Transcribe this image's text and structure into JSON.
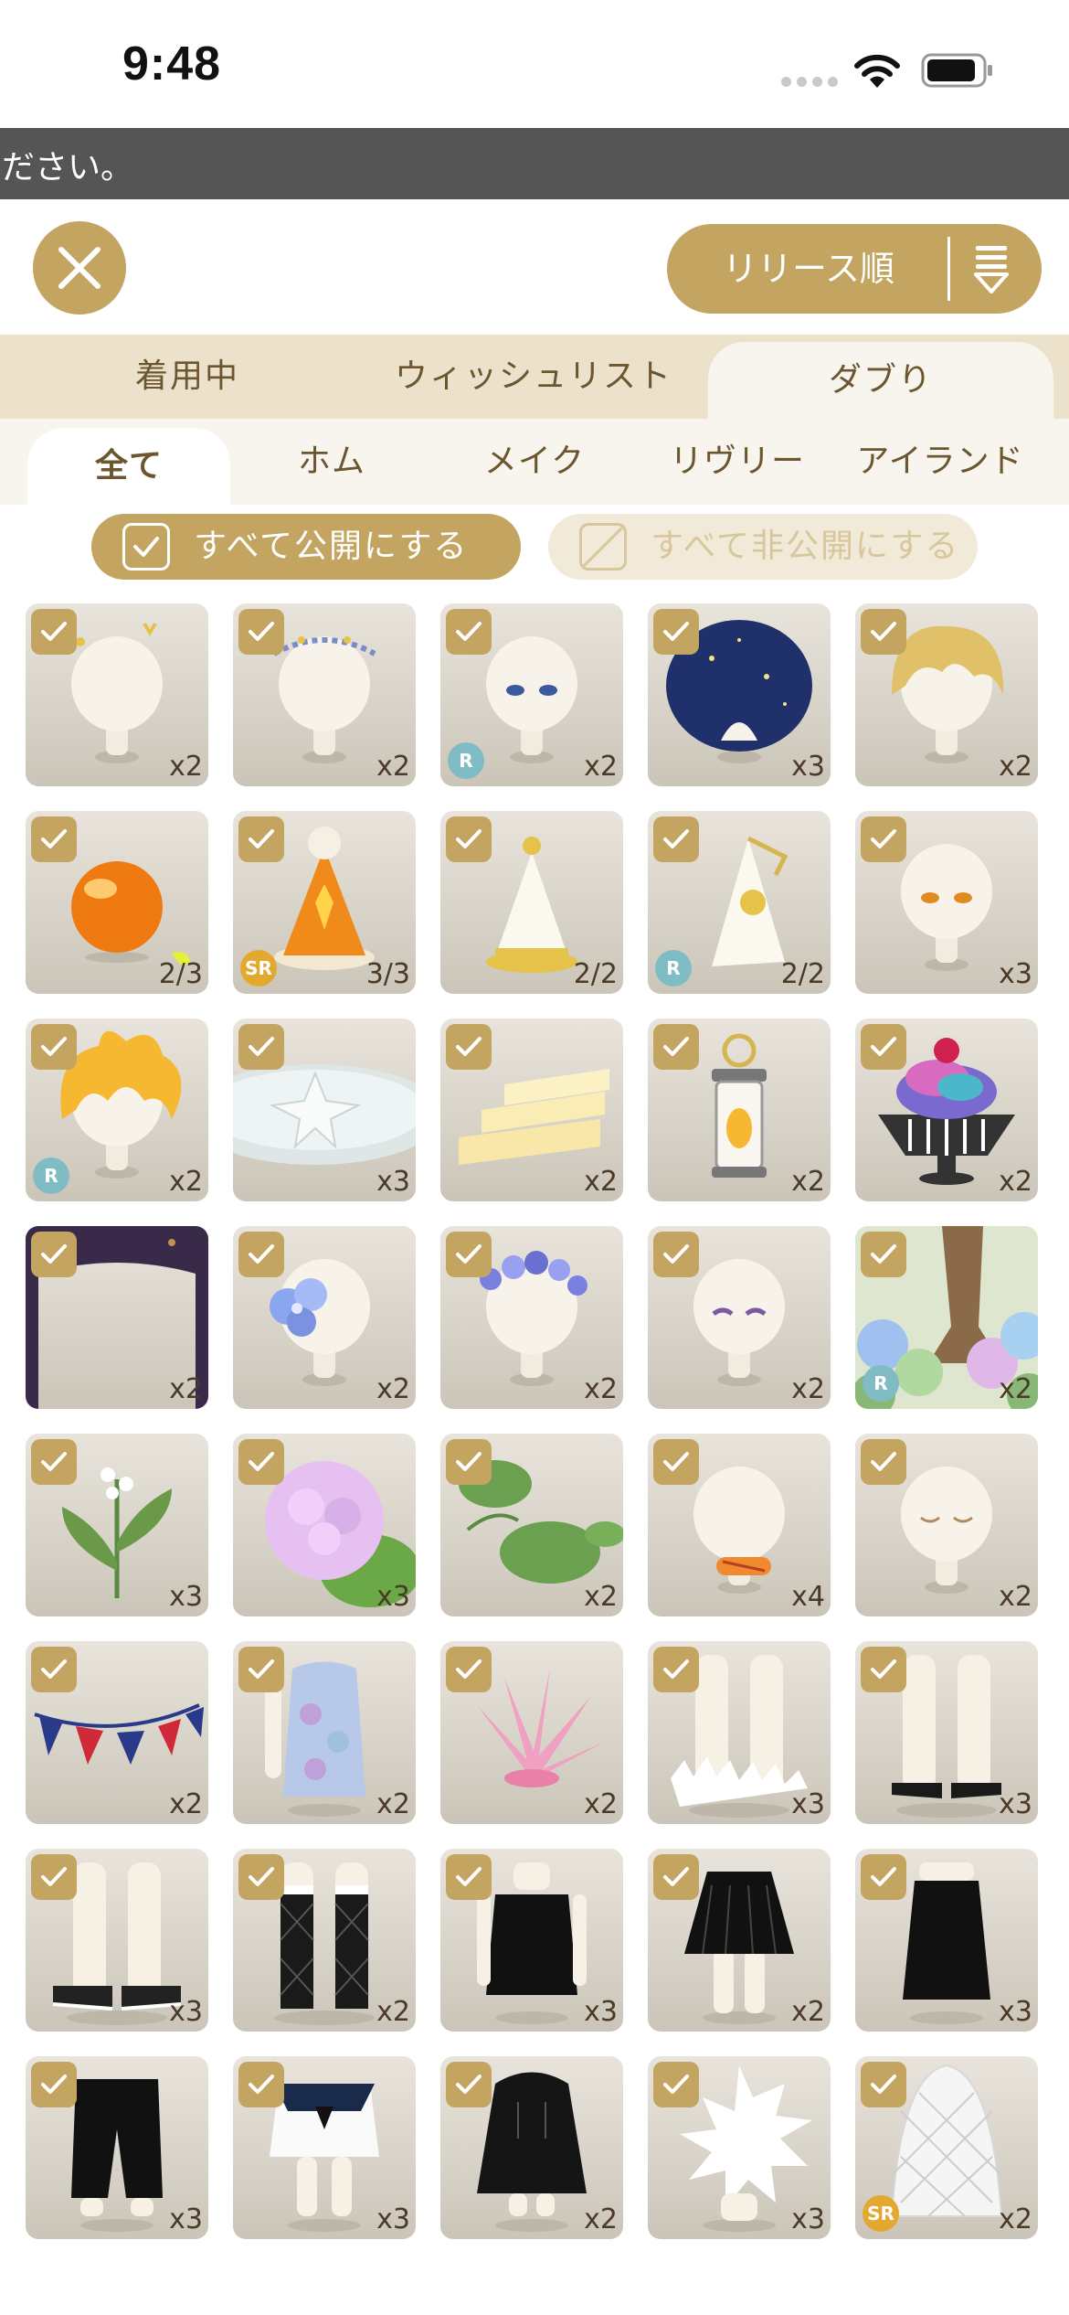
{
  "status_bar": {
    "time": "9:48"
  },
  "banner": {
    "text": "ださい。"
  },
  "header": {
    "sort_label": "リリース順"
  },
  "main_tabs": [
    {
      "label": "着用中",
      "active": false
    },
    {
      "label": "ウィッシュリスト",
      "active": false
    },
    {
      "label": "ダブり",
      "active": true
    }
  ],
  "sub_tabs": [
    {
      "label": "全て",
      "active": true
    },
    {
      "label": "ホム",
      "active": false
    },
    {
      "label": "メイク",
      "active": false
    },
    {
      "label": "リヴリー",
      "active": false
    },
    {
      "label": "アイランド",
      "active": false
    }
  ],
  "visibility": {
    "public_label": "すべて公開にする",
    "private_label": "すべて非公開にする"
  },
  "items": [
    {
      "art": "head-tiara",
      "count": "x2",
      "badge": ""
    },
    {
      "art": "head-laurel",
      "count": "x2",
      "badge": ""
    },
    {
      "art": "head-blue-eyes",
      "count": "x2",
      "badge": "R"
    },
    {
      "art": "starry-hair",
      "count": "x3",
      "badge": ""
    },
    {
      "art": "blonde-hair",
      "count": "x2",
      "badge": ""
    },
    {
      "art": "orange-orb",
      "count": "2/3",
      "badge": ""
    },
    {
      "art": "party-hat-orange",
      "count": "3/3",
      "badge": "SR"
    },
    {
      "art": "party-hat-white",
      "count": "2/2",
      "badge": ""
    },
    {
      "art": "party-hat-sun",
      "count": "2/2",
      "badge": "R"
    },
    {
      "art": "head-amber-eyes",
      "count": "x3",
      "badge": ""
    },
    {
      "art": "flame-hair",
      "count": "x2",
      "badge": "R"
    },
    {
      "art": "star-plate",
      "count": "x3",
      "badge": ""
    },
    {
      "art": "cake-stairs",
      "count": "x2",
      "badge": ""
    },
    {
      "art": "lantern",
      "count": "x2",
      "badge": ""
    },
    {
      "art": "parfait",
      "count": "x2",
      "badge": ""
    },
    {
      "art": "dark-frame",
      "count": "x2",
      "badge": ""
    },
    {
      "art": "blue-flower-clip",
      "count": "x2",
      "badge": ""
    },
    {
      "art": "hydrangea-crown",
      "count": "x2",
      "badge": ""
    },
    {
      "art": "head-violet-eyes",
      "count": "x2",
      "badge": ""
    },
    {
      "art": "hydrangea-tree",
      "count": "x2",
      "badge": "R"
    },
    {
      "art": "white-flower-plant",
      "count": "x3",
      "badge": ""
    },
    {
      "art": "pink-hydrangea",
      "count": "x3",
      "badge": ""
    },
    {
      "art": "lotus-leaves",
      "count": "x2",
      "badge": ""
    },
    {
      "art": "head-sausage",
      "count": "x4",
      "badge": ""
    },
    {
      "art": "head-sleepy",
      "count": "x2",
      "badge": ""
    },
    {
      "art": "bunting",
      "count": "x2",
      "badge": ""
    },
    {
      "art": "mermaid-dress",
      "count": "x2",
      "badge": ""
    },
    {
      "art": "pink-plant",
      "count": "x2",
      "badge": ""
    },
    {
      "art": "fluffy-boots",
      "count": "x3",
      "badge": ""
    },
    {
      "art": "black-shoes",
      "count": "x3",
      "badge": ""
    },
    {
      "art": "sneakers",
      "count": "x3",
      "badge": ""
    },
    {
      "art": "fishnet-socks",
      "count": "x2",
      "badge": ""
    },
    {
      "art": "black-camisole",
      "count": "x3",
      "badge": ""
    },
    {
      "art": "black-skirt",
      "count": "x2",
      "badge": ""
    },
    {
      "art": "black-long-skirt",
      "count": "x3",
      "badge": ""
    },
    {
      "art": "black-pants",
      "count": "x3",
      "badge": ""
    },
    {
      "art": "sailor-top",
      "count": "x3",
      "badge": ""
    },
    {
      "art": "black-hoodie",
      "count": "x2",
      "badge": ""
    },
    {
      "art": "white-fluff",
      "count": "x3",
      "badge": ""
    },
    {
      "art": "lace-veil",
      "count": "x2",
      "badge": "SR"
    }
  ],
  "colors": {
    "accent": "#c3a461",
    "banner": "#555555",
    "tab_bar": "#ece2cc",
    "rarity_r": "#7fbcc3",
    "rarity_sr": "#e3a92f"
  }
}
